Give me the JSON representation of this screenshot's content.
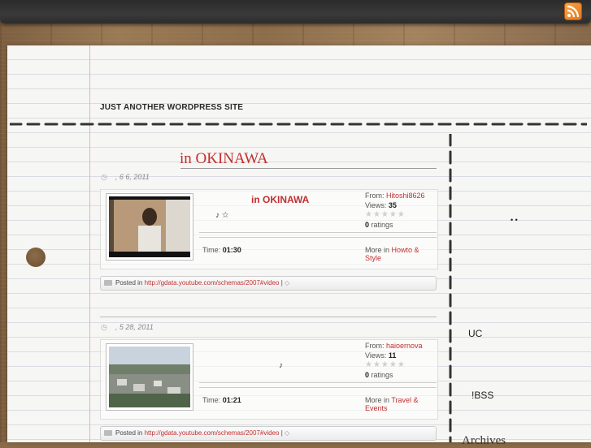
{
  "site": {
    "title": "JUST ANOTHER WORDPRESS SITE"
  },
  "posts": [
    {
      "title": "in OKINAWA",
      "date": ", 6  6, 2011",
      "video": {
        "title": "in OKINAWA",
        "symbols": "♪     ☆",
        "from_label": "From:",
        "from": "Hitoshi8626",
        "views_label": "Views:",
        "views": "35",
        "stars": "★★★★★",
        "ratings_count": "0",
        "ratings_label": "ratings",
        "time_label": "Time:",
        "time": "01:30",
        "more_label": "More in",
        "category": "Howto & Style"
      },
      "posted_label": "Posted in",
      "posted_link": "http://gdata.youtube.com/schemas/2007#video",
      "posted_sep": "|"
    },
    {
      "title": "",
      "date": ", 5  28, 2011",
      "video": {
        "title": "",
        "symbols": "♪",
        "from_label": "From:",
        "from": "haioernova",
        "views_label": "Views:",
        "views": "11",
        "stars": "★★★★★",
        "ratings_count": "0",
        "ratings_label": "ratings",
        "time_label": "Time:",
        "time": "01:21",
        "more_label": "More in",
        "category": "Travel & Events"
      },
      "posted_label": "Posted in",
      "posted_link": "http://gdata.youtube.com/schemas/2007#video",
      "posted_sep": "|"
    }
  ],
  "sidebar": {
    "dots": "• •",
    "item1": "UC",
    "item2": "!BSS",
    "archives": "Archives"
  },
  "icons": {
    "rss": "rss-icon",
    "clock": "clock-icon",
    "folder": "folder-icon",
    "tag": "tag-icon"
  },
  "colors": {
    "accent": "#c03030",
    "paper": "#f6f6f4",
    "bar": "#2f2f2f"
  }
}
